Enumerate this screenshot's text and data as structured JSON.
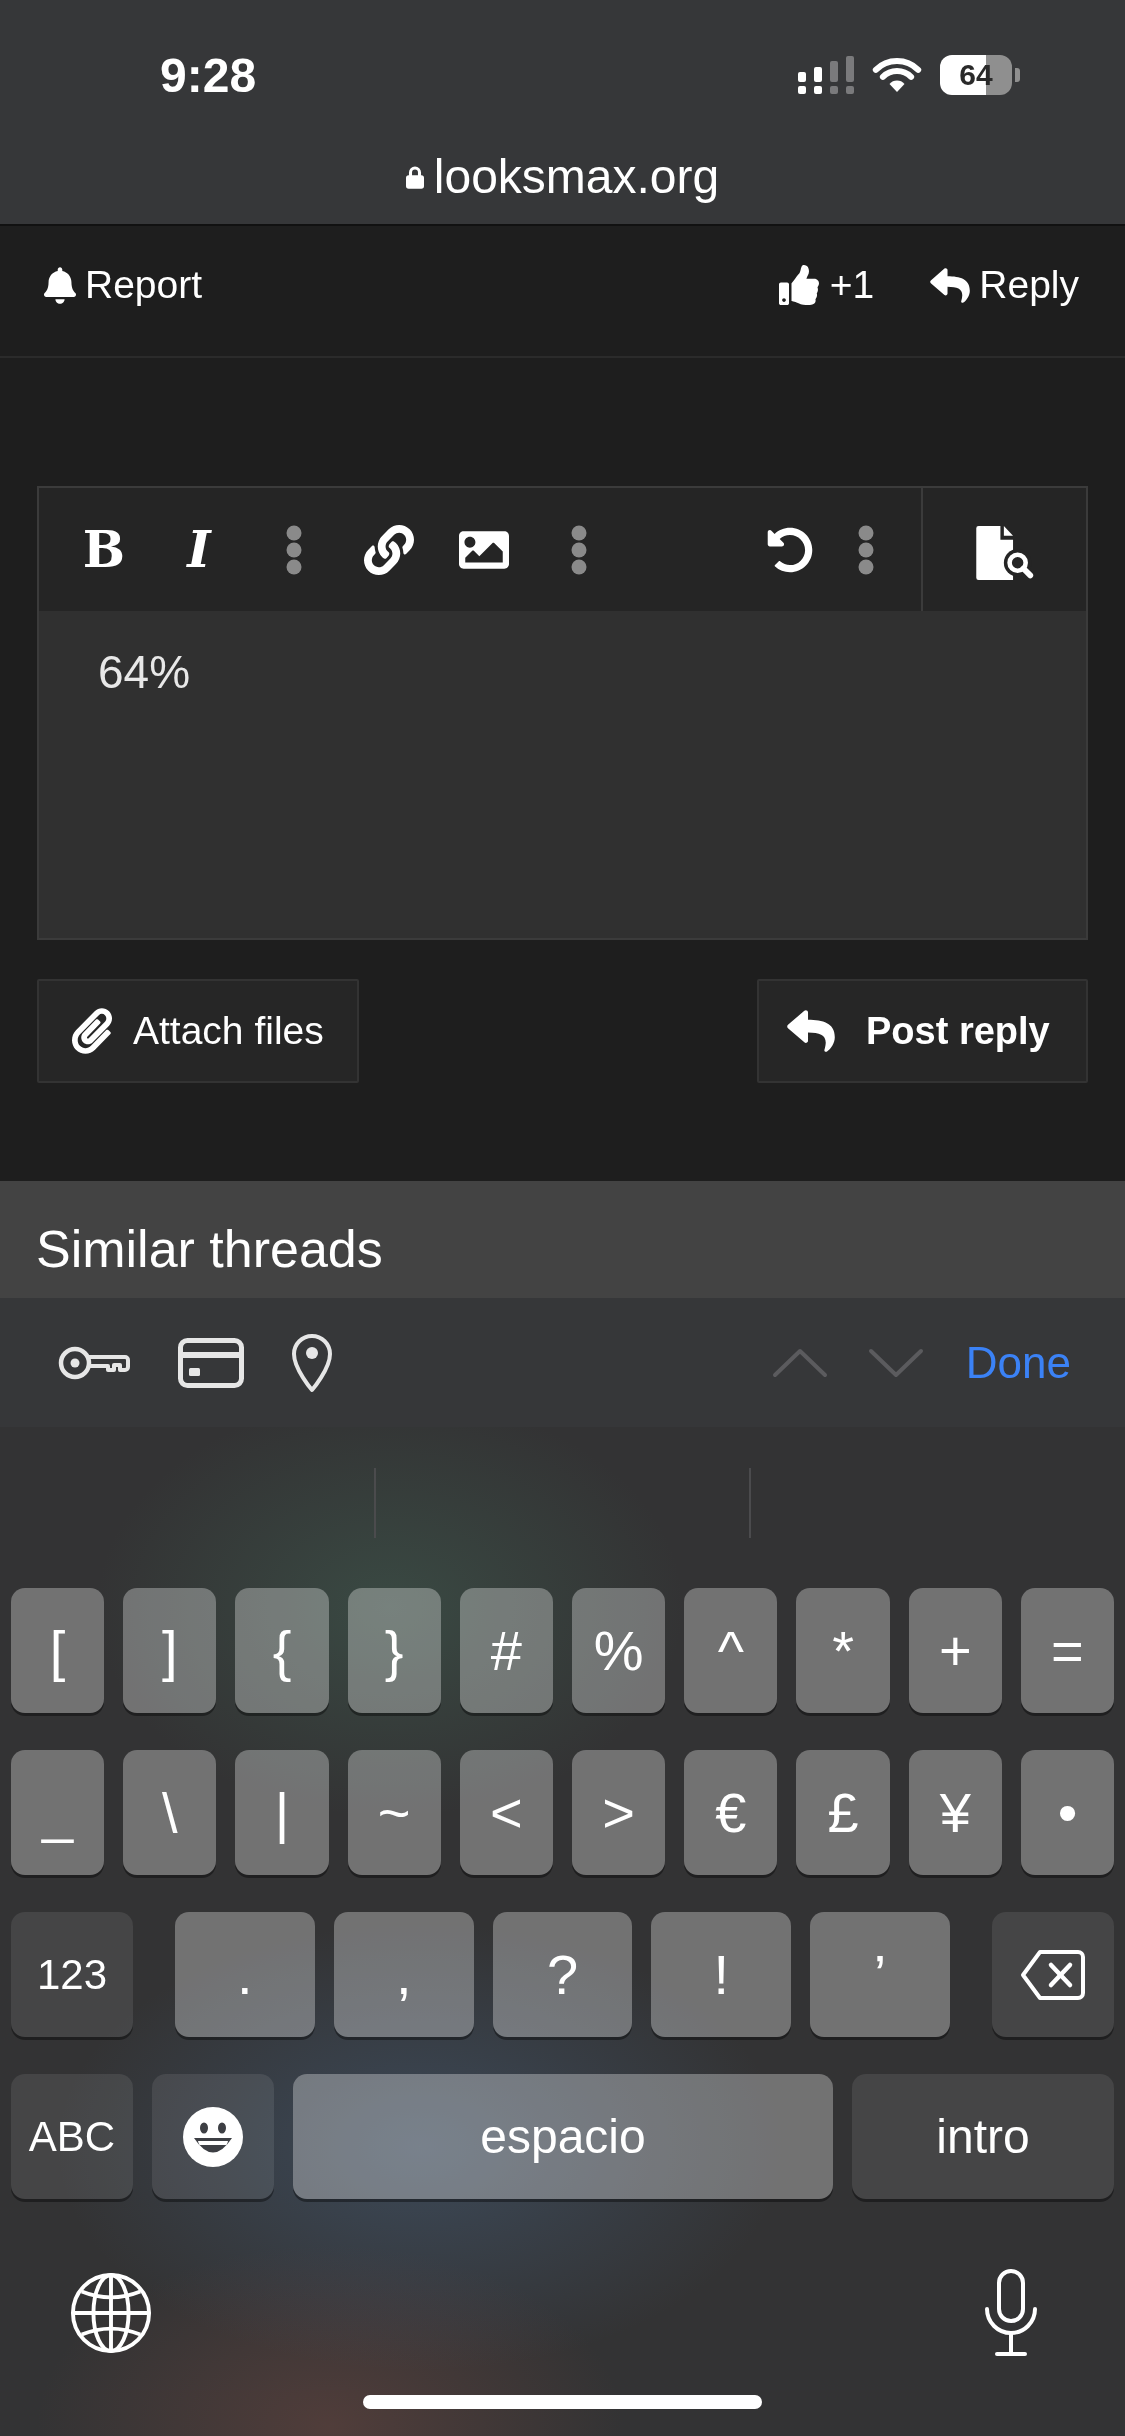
{
  "status_bar": {
    "time": "9:28",
    "battery": "64"
  },
  "address_bar": {
    "url": "looksmax.org"
  },
  "post_actions": [
    {
      "kind": "report",
      "label": "Report"
    },
    {
      "kind": "like",
      "label": "+1"
    },
    {
      "kind": "reply",
      "label": "Reply"
    }
  ],
  "editor": {
    "toolbar": [
      {
        "kind": "bold",
        "label": "B"
      },
      {
        "kind": "italic",
        "label": "I"
      },
      {
        "kind": "more"
      },
      {
        "kind": "link"
      },
      {
        "kind": "image"
      },
      {
        "kind": "more"
      },
      {
        "kind": "undo"
      },
      {
        "kind": "more"
      },
      {
        "kind": "preview"
      }
    ],
    "value": "64%"
  },
  "form_buttons": [
    {
      "kind": "attach",
      "label": "Attach files"
    },
    {
      "kind": "post",
      "label": "Post reply"
    }
  ],
  "similar_threads": {
    "title": "Similar threads"
  },
  "keyboard_toolbar": {
    "nav": [
      {
        "kind": "previous",
        "disabled": true
      },
      {
        "kind": "next",
        "disabled": true
      }
    ],
    "done": "Done"
  },
  "keyboard": {
    "key_rows": [
      {
        "keys": [
          {
            "kind": "char",
            "label": "["
          },
          {
            "kind": "char",
            "label": "]"
          },
          {
            "kind": "char",
            "label": "{"
          },
          {
            "kind": "char",
            "label": "}"
          },
          {
            "kind": "char",
            "label": "#"
          },
          {
            "kind": "char",
            "label": "%"
          },
          {
            "kind": "char",
            "label": "^"
          },
          {
            "kind": "char",
            "label": "*"
          },
          {
            "kind": "char",
            "label": "+"
          },
          {
            "kind": "char",
            "label": "="
          }
        ]
      },
      {
        "keys": [
          {
            "kind": "char",
            "label": "_"
          },
          {
            "kind": "char",
            "label": "\\"
          },
          {
            "kind": "char",
            "label": "|"
          },
          {
            "kind": "char",
            "label": "~"
          },
          {
            "kind": "char",
            "label": "<"
          },
          {
            "kind": "char",
            "label": ">"
          },
          {
            "kind": "char",
            "label": "€"
          },
          {
            "kind": "char",
            "label": "£"
          },
          {
            "kind": "char",
            "label": "¥"
          },
          {
            "kind": "char",
            "label": "•"
          }
        ]
      },
      {
        "keys": [
          {
            "kind": "mode",
            "label": "123"
          },
          {
            "kind": "char",
            "label": "."
          },
          {
            "kind": "char",
            "label": ","
          },
          {
            "kind": "char",
            "label": "?"
          },
          {
            "kind": "char",
            "label": "!"
          },
          {
            "kind": "char",
            "label": "’"
          },
          {
            "kind": "delete"
          }
        ]
      },
      {
        "keys": [
          {
            "kind": "mode",
            "label": "ABC"
          },
          {
            "kind": "emoji"
          },
          {
            "kind": "space",
            "label": "espacio"
          },
          {
            "kind": "return",
            "label": "intro"
          }
        ]
      }
    ]
  }
}
